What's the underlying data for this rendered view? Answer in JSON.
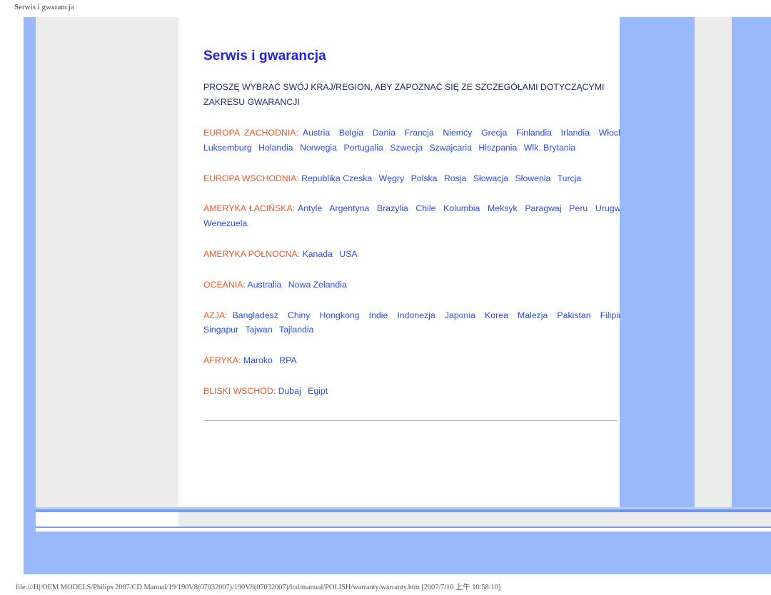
{
  "browser": {
    "window_title": "Serwis i gwarancja",
    "status_url": "file:///H|/OEM MODELS/Philips 2007/CD Manual/19/190V8(07032007)/190V8(07032007)/lcd/manual/POLISH/warranty/warranty.htm [2007/7/10 上午 10:58:10]"
  },
  "colors": {
    "heading": "#2222dd",
    "intro_text": "#1f2b6e",
    "region_label": "#f05a28",
    "country_link": "#2a4df5",
    "rail_blue": "#99b9fb",
    "sidebar_grey": "#ececec",
    "accent_deep_blue": "#7a9ef0",
    "divider_grey": "#b9b9b9"
  },
  "document": {
    "title": "Serwis i gwarancja",
    "intro": "PROSZĘ WYBRAĆ SWÓJ KRAJ/REGION, ABY ZAPOZNAĆ SIĘ ZE SZCZEGÓŁAMI DOTYCZĄCYMI ZAKRESU GWARANCJI",
    "regions": [
      {
        "label": "EUROPA ZACHODNIA:",
        "countries": [
          "Austria",
          "Belgia",
          "Dania",
          "Francja",
          "Niemcy",
          "Grecja",
          "Finlandia",
          "Irlandia",
          "Włochy",
          "Luksemburg",
          "Holandia",
          "Norwegia",
          "Portugalia",
          "Szwecja",
          "Szwajcaria",
          "Hiszpania",
          "Wlk. Brytania"
        ]
      },
      {
        "label": "EUROPA WSCHODNIA:",
        "countries": [
          "Republika Czeska",
          "Węgry",
          "Polska",
          "Rosja",
          "Słowacja",
          "Słowenia",
          "Turcja"
        ]
      },
      {
        "label": "AMERYKA ŁACIŃSKA:",
        "countries": [
          "Antyle",
          "Argentyna",
          "Brazylia",
          "Chile",
          "Kolumbia",
          "Meksyk",
          "Paragwaj",
          "Peru",
          "Urugwaj",
          "Wenezuela"
        ]
      },
      {
        "label": "AMERYKA PÓŁNOCNA:",
        "countries": [
          "Kanada",
          "USA"
        ]
      },
      {
        "label": "OCEANIA:",
        "countries": [
          "Australia",
          "Nowa Zelandia"
        ]
      },
      {
        "label": "AZJA:",
        "countries": [
          "Bangladesz",
          "Chiny",
          "Hongkong",
          "Indie",
          "Indonezja",
          "Japonia",
          "Korea",
          "Malezja",
          "Pakistan",
          "Filipiny",
          "Singapur",
          "Tajwan",
          "Tajlandia"
        ]
      },
      {
        "label": "AFRYKA:",
        "countries": [
          "Maroko",
          "RPA"
        ]
      },
      {
        "label": "BLISKI WSCHÓD:",
        "countries": [
          "Dubaj",
          "Egipt"
        ]
      }
    ]
  }
}
